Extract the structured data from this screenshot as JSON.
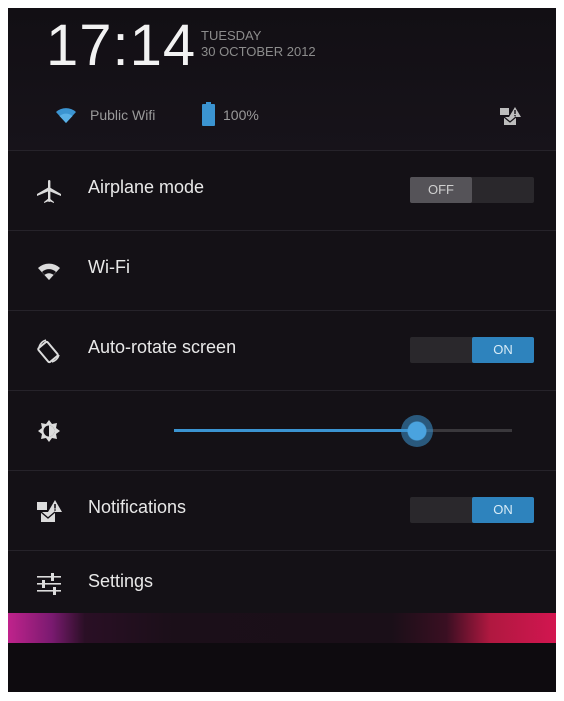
{
  "header": {
    "time": "17:14",
    "day": "TUESDAY",
    "date": "30 OCTOBER 2012",
    "network_name": "Public Wifi",
    "battery_level": "100%"
  },
  "quick_settings": {
    "airplane_mode": {
      "label": "Airplane mode",
      "toggle_label": "OFF",
      "state": "off"
    },
    "wifi": {
      "label": "Wi-Fi"
    },
    "auto_rotate": {
      "label": "Auto-rotate screen",
      "toggle_label": "ON",
      "state": "on"
    },
    "brightness": {
      "level": 0.72
    },
    "notifications": {
      "label": "Notifications",
      "toggle_label": "ON",
      "state": "on"
    },
    "settings": {
      "label": "Settings"
    }
  },
  "icons": {
    "wifi": "wifi-icon",
    "battery": "battery-icon",
    "notifications": "notifications-icon",
    "airplane": "airplane-icon",
    "rotate": "rotate-icon",
    "brightness": "brightness-icon",
    "settings": "settings-sliders-icon"
  },
  "colors": {
    "accent": "#3b94d1",
    "toggle_on": "#2e83bd",
    "toggle_off": "#555358",
    "background": "#141116"
  }
}
